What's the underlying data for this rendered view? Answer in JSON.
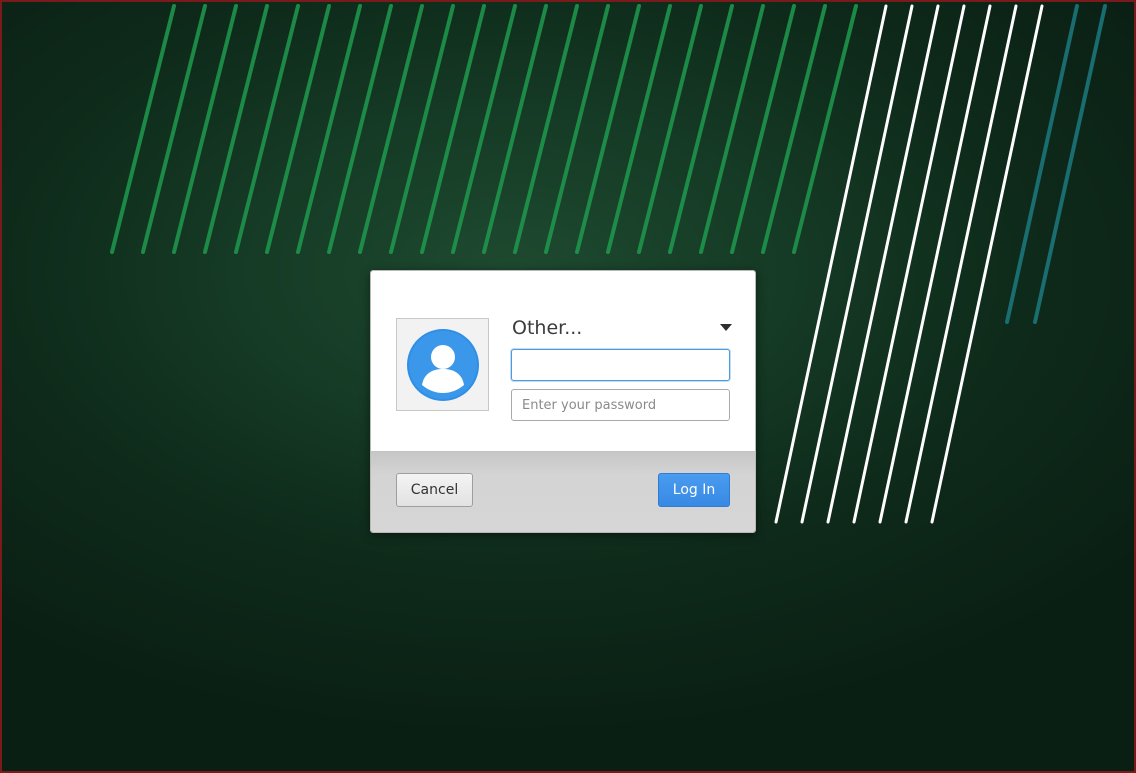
{
  "dialog": {
    "user_selector": {
      "selected": "Other..."
    },
    "username_field": {
      "value": "",
      "placeholder": ""
    },
    "password_field": {
      "value": "",
      "placeholder": "Enter your password"
    },
    "cancel_label": "Cancel",
    "login_label": "Log In"
  },
  "icons": {
    "avatar": "user-avatar-icon",
    "dropdown": "chevron-down-icon"
  },
  "colors": {
    "accent": "#3b8de8",
    "avatar": "#2f8fe6",
    "wallpaper_dark": "#0e2a1a",
    "wallpaper_stripe_green": "#1f9a4e",
    "wallpaper_stripe_teal": "#1d7f86",
    "wallpaper_stripe_white": "#ffffff"
  }
}
